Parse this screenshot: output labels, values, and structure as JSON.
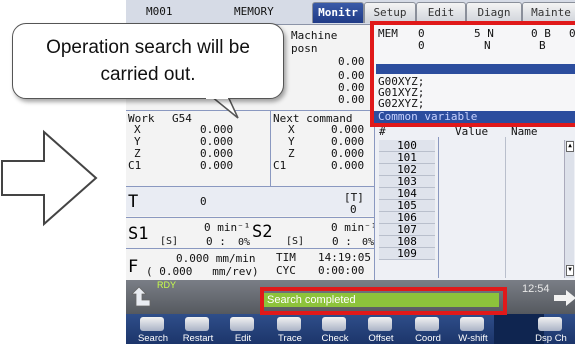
{
  "callout": {
    "line1": "Operation search will be",
    "line2": "carried out."
  },
  "status": {
    "program": "M001",
    "mode": "MEMORY"
  },
  "tabs": [
    {
      "label": "Monitr",
      "active": true
    },
    {
      "label": "Setup",
      "active": false
    },
    {
      "label": "Edit",
      "active": false
    },
    {
      "label": "Diagn",
      "active": false
    },
    {
      "label": "Mainte",
      "active": false
    }
  ],
  "machine_posn": {
    "title": "Machine posn",
    "values": [
      "0.00",
      "0.00",
      "0.00",
      "0.00"
    ]
  },
  "program_box": {
    "row1": {
      "mem": "MEM",
      "a": "0",
      "b": "5 N",
      "c": "0 B",
      "d": "0"
    },
    "row2": {
      "a": "0",
      "b": "N",
      "c": "B"
    },
    "lines": [
      "G00XYZ;",
      "G01XYZ;",
      "G02XYZ;"
    ],
    "footer": "Common variable"
  },
  "work": {
    "title": "Work",
    "code": "G54",
    "axes": [
      {
        "name": "X",
        "value": "0.000"
      },
      {
        "name": "Y",
        "value": "0.000"
      },
      {
        "name": "Z",
        "value": "0.000"
      },
      {
        "name": "C1",
        "value": "0.000"
      }
    ]
  },
  "next_command": {
    "title": "Next command",
    "axes": [
      {
        "name": "X",
        "value": "0.000"
      },
      {
        "name": "Y",
        "value": "0.000"
      },
      {
        "name": "Z",
        "value": "0.000"
      },
      {
        "name": "C1",
        "value": "0.000"
      }
    ]
  },
  "tool": {
    "label": "T",
    "value": "0",
    "bracket": "[T]",
    "bracket_value": "0"
  },
  "spindle": {
    "s1": "S1",
    "s1_s": "[S]",
    "s1_rpm": "0 min⁻¹",
    "s1_load": "0 :",
    "s1_pct": "0%",
    "s2": "S2",
    "s2_s": "[S]",
    "s2_rpm": "0 min⁻¹",
    "s2_load": "0 :",
    "s2_pct": "0%"
  },
  "feed": {
    "label": "F",
    "value": "0.000 mm/min",
    "sub": "( 0.000   mm/rev)",
    "tim_label": "TIM",
    "tim": "14:19:05",
    "cyc_label": "CYC",
    "cyc": "0:00:00"
  },
  "variables": {
    "col_num": "#",
    "col_value": "Value",
    "col_name": "Name",
    "rows": [
      "100",
      "101",
      "102",
      "103",
      "104",
      "105",
      "106",
      "107",
      "108",
      "109"
    ]
  },
  "message": {
    "rdy": "RDY",
    "text": "Search completed",
    "clock": "12:54"
  },
  "softkeys": [
    "Search",
    "Restart",
    "Edit",
    "Trace",
    "Check",
    "Offset",
    "Coord",
    "W-shift",
    "",
    "Dsp Ch"
  ]
}
